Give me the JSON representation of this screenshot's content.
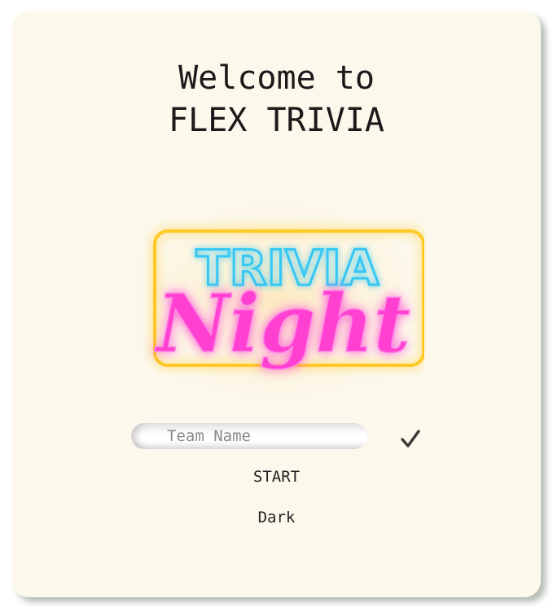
{
  "welcome": {
    "line1": "Welcome to",
    "line2": "FLEX TRIVIA"
  },
  "logo": {
    "word_top": "TRIVIA",
    "word_bottom": "Night",
    "frame_color": "#ffc928",
    "top_color": "#36c8f4",
    "bottom_color": "#ff3fd0"
  },
  "team": {
    "placeholder": "Team Name",
    "confirm_icon": "checkmark-icon"
  },
  "actions": {
    "start_label": "START",
    "theme_label": "Dark"
  }
}
